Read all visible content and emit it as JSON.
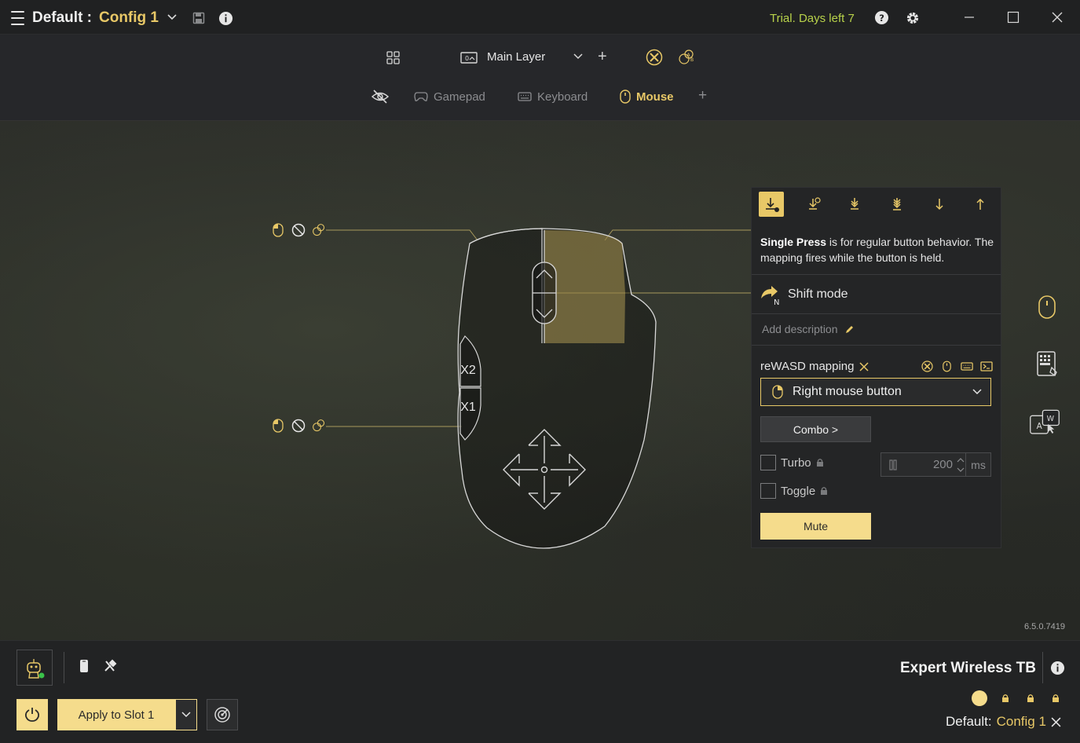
{
  "titlebar": {
    "profile": "Default :",
    "config": "Config 1",
    "trial": "Trial. Days left 7"
  },
  "layer": {
    "name": "Main Layer"
  },
  "device_tabs": [
    {
      "label": "Gamepad"
    },
    {
      "label": "Keyboard"
    },
    {
      "label": "Mouse"
    }
  ],
  "mouse_labels": {
    "x2": "X2",
    "x1": "X1"
  },
  "panel": {
    "desc_bold": "Single Press",
    "desc_rest": " is for regular button behavior. The mapping fires while the button is held.",
    "shift_label": "Shift mode",
    "shift_sub": "N",
    "add_description": "Add description",
    "mapping_label": "reWASD mapping",
    "mapping_value": "Right mouse button",
    "combo": "Combo >",
    "turbo": "Turbo",
    "toggle": "Toggle",
    "ms_value": "200",
    "ms_unit": "ms",
    "mute": "Mute"
  },
  "version": "6.5.0.7419",
  "bottom": {
    "apply": "Apply to Slot 1",
    "device": "Expert Wireless TB",
    "footer_profile": "Default:",
    "footer_config": "Config 1"
  },
  "colors": {
    "accent": "#e8c867",
    "button_fill": "#f5dc8c",
    "trial": "#b8d24a"
  }
}
